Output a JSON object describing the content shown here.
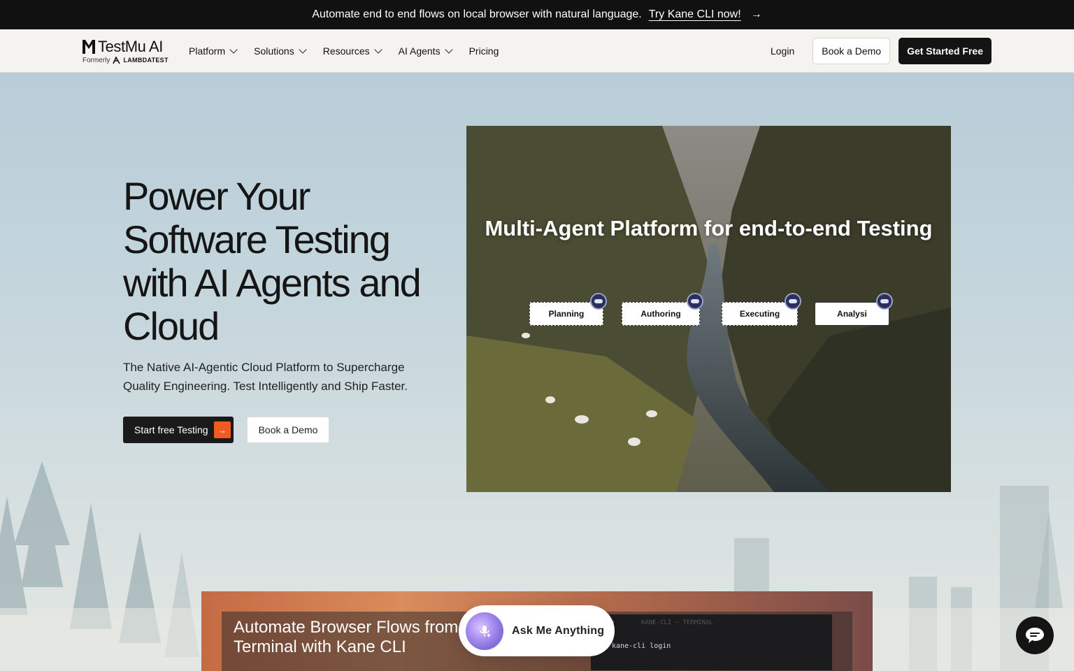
{
  "announcement": {
    "text": "Automate end to end flows on local browser with natural language.",
    "cta": "Try Kane CLI now!",
    "arrow": "→"
  },
  "nav": {
    "logo": {
      "name": "TestMu AI",
      "formerly": "Formerly",
      "former_brand": "LAMBDATEST"
    },
    "links": [
      {
        "label": "Platform",
        "dropdown": true
      },
      {
        "label": "Solutions",
        "dropdown": true
      },
      {
        "label": "Resources",
        "dropdown": true
      },
      {
        "label": "AI Agents",
        "dropdown": true
      },
      {
        "label": "Pricing",
        "dropdown": false
      }
    ],
    "login": "Login",
    "book_demo": "Book a Demo",
    "get_started": "Get Started Free"
  },
  "hero": {
    "title": "Power Your Software Testing with AI Agents and Cloud",
    "subtitle": "The Native AI-Agentic Cloud Platform to Supercharge Quality Engineering. Test Intelligently and Ship Faster.",
    "start_button": "Start free Testing",
    "start_arrow": "→",
    "demo_button": "Book a Demo"
  },
  "video": {
    "title": "Multi-Agent Platform for end-to-end Testing",
    "stages": [
      "Planning",
      "Authoring",
      "Executing",
      "Analysi"
    ]
  },
  "bottom_card": {
    "title": "Automate Browser Flows from Terminal with Kane CLI",
    "terminal_title": "KANE-CLI — TERMINAL",
    "prompt": "$",
    "command": "kane-cli login"
  },
  "ask": {
    "label": "Ask Me Anything"
  },
  "colors": {
    "accent": "#f15a22",
    "dark": "#141414",
    "announce_bg": "#111111"
  },
  "icons": [
    "arrow-right-icon",
    "chevron-down-icon",
    "mic-sparkle-icon",
    "chat-icon",
    "agent-badge-icon"
  ]
}
